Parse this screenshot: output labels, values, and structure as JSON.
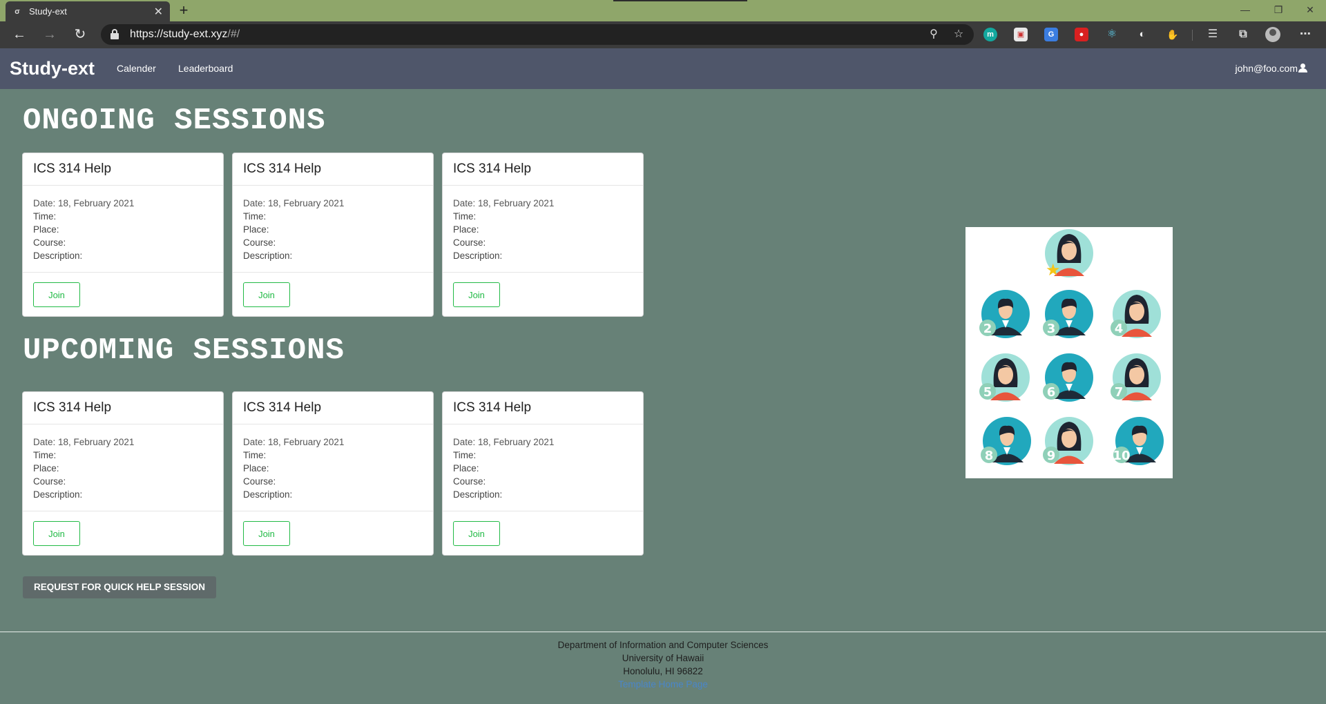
{
  "browser": {
    "tab_title": "Study-ext",
    "tab_favicon": "σ",
    "url_main": "https://study-ext.xyz",
    "url_rest": "/#/"
  },
  "site": {
    "brand": "Study-ext",
    "nav": [
      "Calender",
      "Leaderboard"
    ],
    "user": "john@foo.com"
  },
  "ongoing": {
    "title": "ONGOING SESSIONS",
    "cards": [
      {
        "title": "ICS 314 Help",
        "date": "Date: 18, February 2021",
        "time": "Time:",
        "place": "Place:",
        "course": "Course:",
        "description": "Description:",
        "button": "Join"
      },
      {
        "title": "ICS 314 Help",
        "date": "Date: 18, February 2021",
        "time": "Time:",
        "place": "Place:",
        "course": "Course:",
        "description": "Description:",
        "button": "Join"
      },
      {
        "title": "ICS 314 Help",
        "date": "Date: 18, February 2021",
        "time": "Time:",
        "place": "Place:",
        "course": "Course:",
        "description": "Description:",
        "button": "Join"
      }
    ]
  },
  "upcoming": {
    "title": "UPCOMING SESSIONS",
    "cards": [
      {
        "title": "ICS 314 Help",
        "date": "Date: 18, February 2021",
        "time": "Time:",
        "place": "Place:",
        "course": "Course:",
        "description": "Description:",
        "button": "Join"
      },
      {
        "title": "ICS 314 Help",
        "date": "Date: 18, February 2021",
        "time": "Time:",
        "place": "Place:",
        "course": "Course:",
        "description": "Description:",
        "button": "Join"
      },
      {
        "title": "ICS 314 Help",
        "date": "Date: 18, February 2021",
        "time": "Time:",
        "place": "Place:",
        "course": "Course:",
        "description": "Description:",
        "button": "Join"
      }
    ]
  },
  "quick_help_button": "REQUEST FOR QUICK HELP SESSION",
  "leaderboard_image": {
    "ranks": [
      "2",
      "3",
      "4",
      "5",
      "6",
      "7",
      "8",
      "9",
      "10"
    ]
  },
  "footer": {
    "line1": "Department of Information and Computer Sciences",
    "line2": "University of Hawaii",
    "line3": "Honolulu, HI 96822",
    "link": "Template Home Page"
  },
  "colors": {
    "page_bg": "#678177",
    "navbar_bg": "#4f566a",
    "join_green": "#21ba45"
  }
}
